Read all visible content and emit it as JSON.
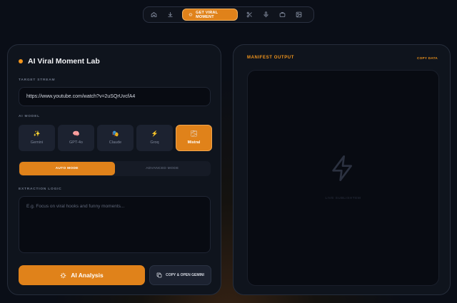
{
  "toolbar": {
    "icons": [
      "home-icon",
      "download-icon",
      "scissors-icon",
      "mic-icon",
      "briefcase-icon",
      "image-icon"
    ],
    "main_button_label": "GET VIRAL MOMENT",
    "accent": "#e0821a"
  },
  "lab": {
    "title": "AI Viral Moment Lab",
    "target_label": "TARGET STREAM",
    "url_value": "https://www.youtube.com/watch?v=2uSQrUvcfA4",
    "model_label": "AI MODEL",
    "models": [
      {
        "icon": "✨",
        "label": "Gemini"
      },
      {
        "icon": "🧠",
        "label": "GPT-4o"
      },
      {
        "icon": "🎭",
        "label": "Claude"
      },
      {
        "icon": "⚡",
        "label": "Groq"
      },
      {
        "icon": "🌫",
        "label": "Mistral"
      }
    ],
    "selected_model": "Mistral",
    "modes": [
      "AUTO MODE",
      "ADVANCED MODE"
    ],
    "selected_mode": "AUTO MODE",
    "logic_label": "EXTRACTION LOGIC",
    "logic_placeholder": "E.g. Focus on viral hooks and funny moments...",
    "analyze_label": "AI Analysis",
    "copy_label": "COPY & OPEN GEMINI"
  },
  "output": {
    "title": "MANIFEST OUTPUT",
    "copy_label": "COPY DATA",
    "empty_text": "LIVE SUBLISHTEM"
  }
}
